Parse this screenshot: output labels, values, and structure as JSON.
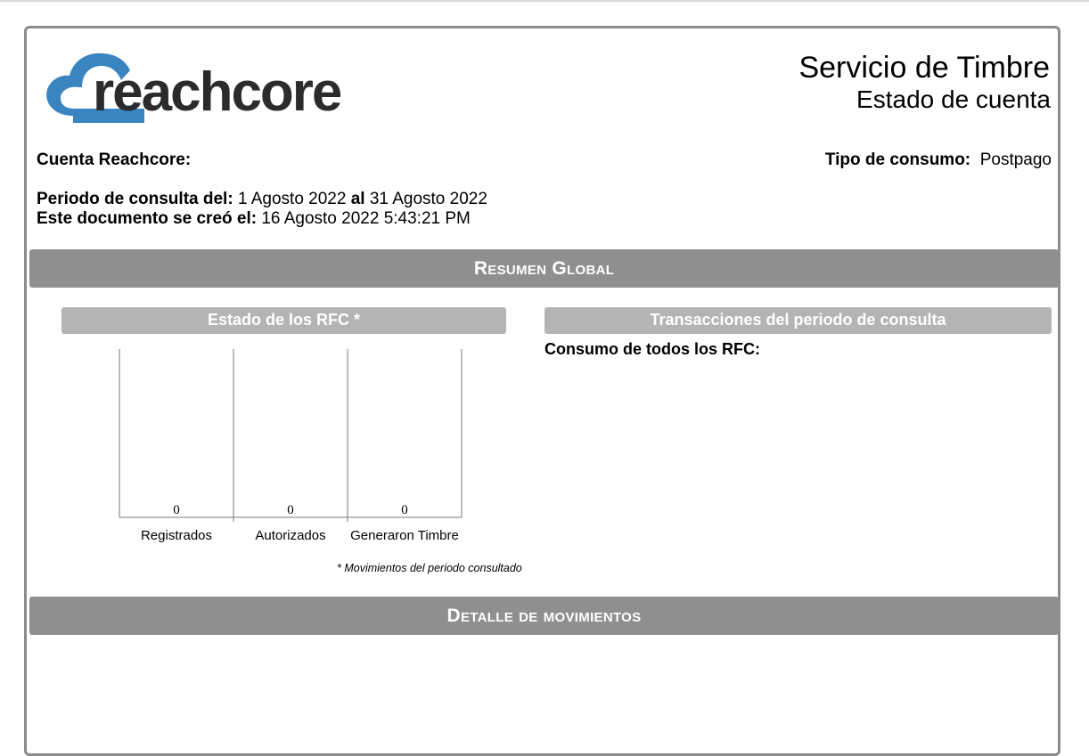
{
  "header": {
    "brand": "reachcore",
    "title": "Servicio de Timbre",
    "subtitle": "Estado de cuenta"
  },
  "account": {
    "cuenta_label": "Cuenta Reachcore:",
    "tipo_label": "Tipo de consumo:",
    "tipo_value": "Postpago",
    "periodo_label": "Periodo de consulta del:",
    "periodo_from": "1 Agosto 2022",
    "periodo_al": "al",
    "periodo_to": "31 Agosto 2022",
    "creado_label": "Este documento se creó el:",
    "creado_value": "16 Agosto 2022 5:43:21 PM"
  },
  "sections": {
    "resumen": "Resumen Global",
    "estado_rfc": "Estado de los RFC *",
    "transacciones": "Transacciones del periodo de consulta",
    "consumo": "Consumo de todos los RFC:",
    "footnote": "* Movimientos del periodo consultado",
    "detalle": "Detalle de movimientos"
  },
  "colors": {
    "band": "#8f8f8f",
    "subband": "#b4b4b4",
    "logo_blue": "#3a84c0",
    "logo_text": "#2b2b2b"
  },
  "chart_data": {
    "type": "bar",
    "categories": [
      "Registrados",
      "Autorizados",
      "Generaron Timbre"
    ],
    "values": [
      0,
      0,
      0
    ]
  }
}
